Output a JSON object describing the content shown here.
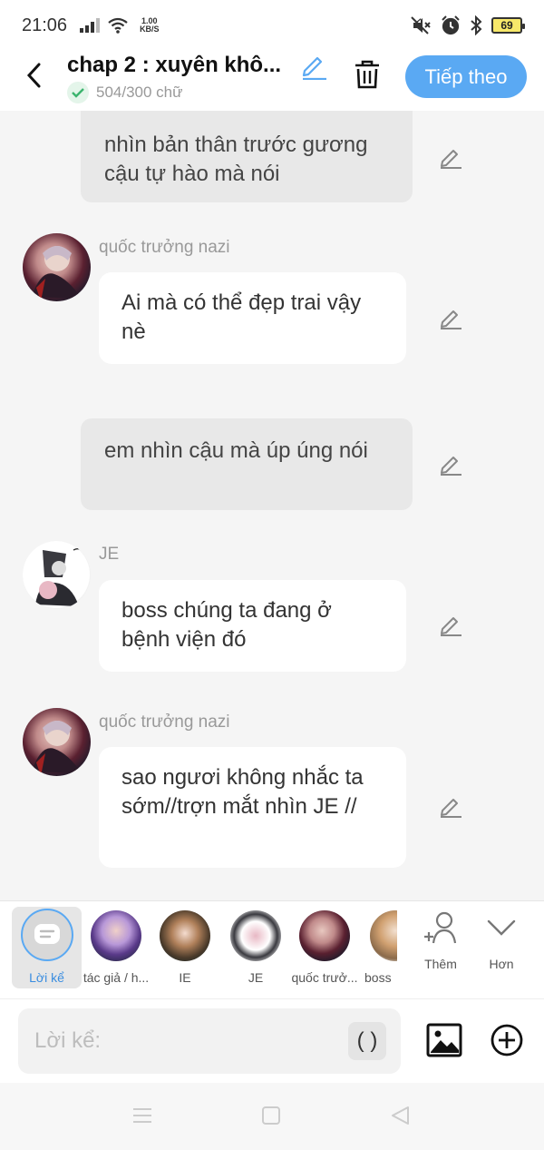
{
  "status_bar": {
    "time": "21:06",
    "net_speed_value": "1.00",
    "net_speed_unit": "KB/S",
    "battery": "69"
  },
  "header": {
    "title": "chap 2 : xuyên khô...",
    "word_count": "504/300 chữ",
    "next_label": "Tiếp theo"
  },
  "messages": [
    {
      "type": "narration",
      "text": "nhìn bản thân trước gương cậu tự hào mà nói"
    },
    {
      "type": "character",
      "name": "quốc trưởng nazi",
      "text": "Ai mà có thể đẹp trai vậy nè"
    },
    {
      "type": "narration",
      "text": "em nhìn cậu mà úp úng nói"
    },
    {
      "type": "character",
      "name": "JE",
      "text": "boss chúng ta đang ở bệnh viện đó"
    },
    {
      "type": "character",
      "name": "quốc trưởng nazi",
      "text": "sao ngươi không nhắc ta sớm//trợn mắt nhìn JE //"
    }
  ],
  "characters": [
    {
      "label": "Lời kể"
    },
    {
      "label": "tác giả / h..."
    },
    {
      "label": "IE"
    },
    {
      "label": "JE"
    },
    {
      "label": "quốc trưở..."
    },
    {
      "label": "boss"
    }
  ],
  "char_actions": {
    "add_label": "Thêm",
    "more_label": "Hơn"
  },
  "input": {
    "placeholder": "Lời kể:",
    "paren_label": "( )"
  },
  "colors": {
    "accent": "#5aa9f3",
    "check_green": "#3cb46e",
    "narration_bg": "#e8e8e8",
    "bubble_bg": "#ffffff"
  }
}
